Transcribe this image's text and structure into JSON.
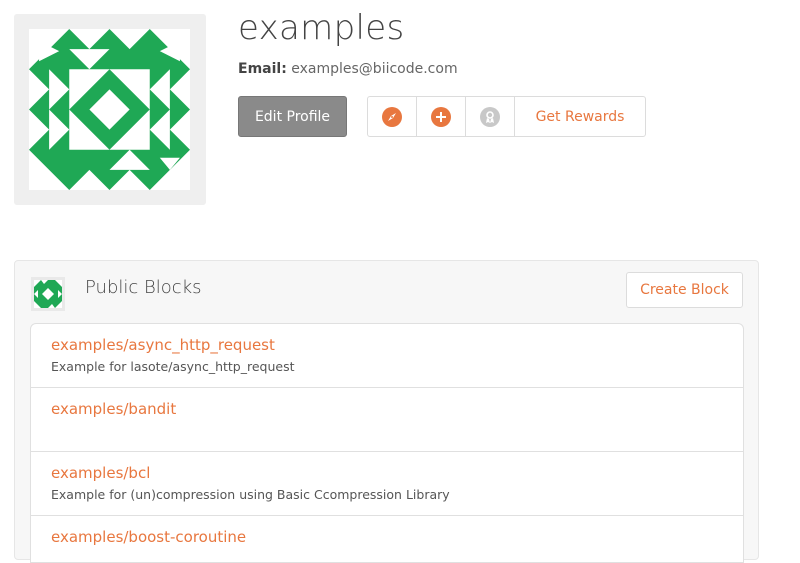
{
  "profile": {
    "username": "examples",
    "email_label": "Email:",
    "email": "examples@biicode.com",
    "edit_profile_label": "Edit Profile"
  },
  "actions": [
    {
      "icon": "compass-icon",
      "color": "#e8773f"
    },
    {
      "icon": "plus-circle-icon",
      "color": "#e8773f"
    },
    {
      "icon": "award-icon",
      "color": "#c8c8c8"
    }
  ],
  "get_rewards_label": "Get Rewards",
  "blocks_panel": {
    "title": "Public Blocks",
    "create_label": "Create Block",
    "items": [
      {
        "name": "examples/async_http_request",
        "description": "Example for lasote/async_http_request"
      },
      {
        "name": "examples/bandit",
        "description": ""
      },
      {
        "name": "examples/bcl",
        "description": "Example for (un)compression using Basic Ccompression Library"
      },
      {
        "name": "examples/boost-coroutine",
        "description": ""
      }
    ]
  },
  "colors": {
    "accent": "#e8773f",
    "identicon": "#1fa855",
    "button_gray": "#8a8a8a"
  }
}
